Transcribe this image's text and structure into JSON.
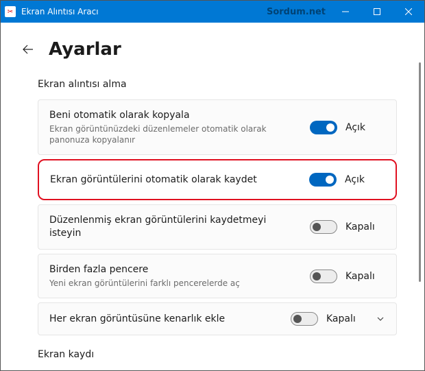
{
  "window": {
    "title": "Ekran Alıntısı Aracı",
    "watermark": "Sordum.net"
  },
  "page": {
    "heading": "Ayarlar"
  },
  "sections": {
    "capture_label": "Ekran alıntısı alma",
    "recording_label": "Ekran kaydı"
  },
  "settings": {
    "auto_copy": {
      "title": "Beni otomatik olarak kopyala",
      "desc": "Ekran görüntünüzdeki düzenlemeler otomatik olarak panonuza kopyalanır",
      "state_label": "Açık"
    },
    "auto_save": {
      "title": "Ekran görüntülerini otomatik olarak kaydet",
      "state_label": "Açık"
    },
    "ask_save_edited": {
      "title": "Düzenlenmiş ekran görüntülerini kaydetmeyi isteyin",
      "state_label": "Kapalı"
    },
    "multi_window": {
      "title": "Birden fazla pencere",
      "desc": "Yeni ekran görüntülerini farklı pencerelerde aç",
      "state_label": "Kapalı"
    },
    "add_border": {
      "title": "Her ekran görüntüsüne kenarlık ekle",
      "state_label": "Kapalı"
    }
  }
}
